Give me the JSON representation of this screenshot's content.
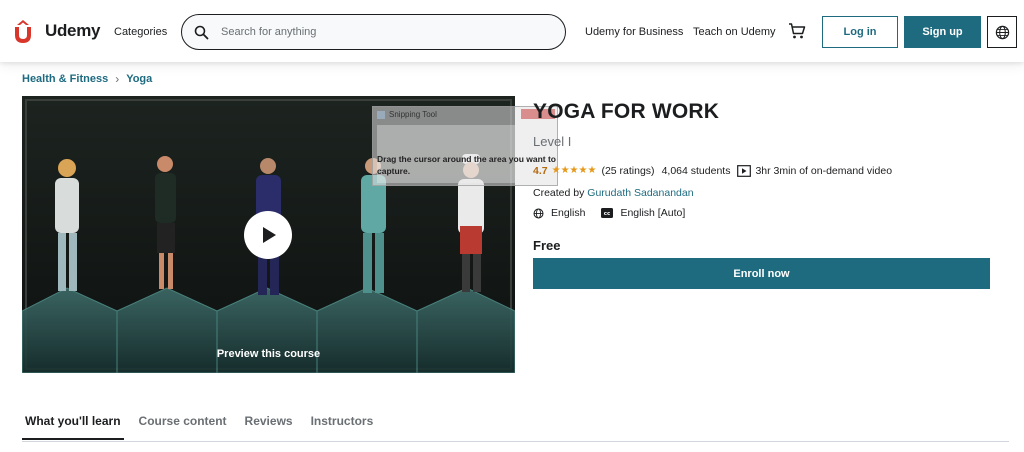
{
  "header": {
    "logo_text": "Udemy",
    "categories_label": "Categories",
    "search_placeholder": "Search for anything",
    "business_link": "Udemy for Business",
    "teach_link": "Teach on Udemy",
    "login_label": "Log in",
    "signup_label": "Sign up",
    "icons": [
      "udemy-logo-icon",
      "search-icon",
      "cart-icon",
      "globe-icon"
    ]
  },
  "breadcrumb": {
    "items": [
      "Health & Fitness",
      "Yoga"
    ]
  },
  "video": {
    "preview_label": "Preview this course",
    "snipping_tool": {
      "title": "Snipping Tool",
      "message": "Drag the cursor around the area you want to capture."
    }
  },
  "course": {
    "title": "YOGA FOR WORK",
    "subtitle": "Level I",
    "rating": "4.7",
    "rating_count": "(25 ratings)",
    "students": "4,064 students",
    "video_length": "3hr 3min of on-demand video",
    "created_by_prefix": "Created by",
    "author": "Gurudath Sadanandan",
    "language": "English",
    "captions": "English [Auto]",
    "price": "Free",
    "enroll_label": "Enroll now"
  },
  "tabs": [
    "What you'll learn",
    "Course content",
    "Reviews",
    "Instructors"
  ],
  "colors": {
    "brand": "#1e6b80",
    "logo": "#a435f0",
    "rating": "#b4690e",
    "star": "#e59819"
  }
}
